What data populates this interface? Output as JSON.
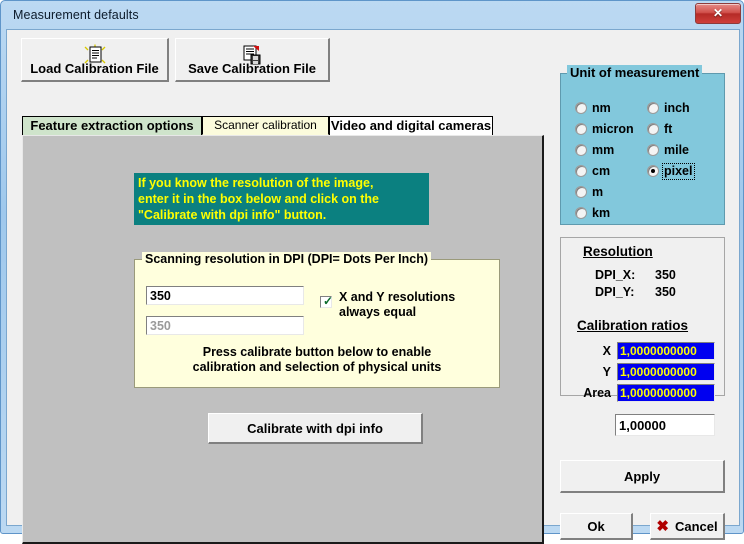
{
  "window": {
    "title": "Measurement defaults",
    "close_label": "✕"
  },
  "toolbar": {
    "load_label": "Load Calibration File",
    "load_icon": "document-sparkle-icon",
    "save_label": "Save Calibration File",
    "save_icon": "document-floppy-icon"
  },
  "tabs": [
    {
      "label": "Feature extraction options",
      "active": false
    },
    {
      "label": "Scanner calibration",
      "active": true
    },
    {
      "label": "Video and digital cameras",
      "active": false
    }
  ],
  "info_box": {
    "line1": "If you know the resolution of the image,",
    "line2": "enter it in the box below and click on the",
    "line3": "\"Calibrate with dpi info\" button.",
    "bg_color": "#0b8080",
    "text_color": "#ffff00"
  },
  "dpi_group": {
    "legend": "Scanning resolution in DPI  (DPI= Dots Per Inch)",
    "x_value": "350",
    "y_value": "350",
    "y_disabled": true,
    "checkbox_checked": true,
    "checkbox_label_line1": "X and Y resolutions",
    "checkbox_label_line2": "always equal",
    "note_line1": "Press calibrate button below to enable",
    "note_line2": "calibration and selection of physical units"
  },
  "calibrate_button": {
    "label": "Calibrate with dpi info"
  },
  "unit_group": {
    "legend": "Unit of measurement",
    "selected": "pixel",
    "left_column": [
      "nm",
      "micron",
      "mm",
      "cm",
      "m",
      "km"
    ],
    "right_column": [
      "inch",
      "ft",
      "mile",
      "pixel"
    ],
    "bg_color": "#82c8dc"
  },
  "resolution": {
    "title": "Resolution",
    "dpi_x_label": "DPI_X:",
    "dpi_x_value": "350",
    "dpi_y_label": "DPI_Y:",
    "dpi_y_value": "350",
    "ratios_title": "Calibration ratios",
    "x_label": "X",
    "x_value": "1,0000000000",
    "y_label": "Y",
    "y_value": "1,0000000000",
    "area_label": "Area",
    "area_value": "1,0000000000",
    "extra_value": "1,00000",
    "field_bg": "#0000f0",
    "field_fg": "#ffff00"
  },
  "actions": {
    "apply_label": "Apply",
    "ok_label": "Ok",
    "cancel_label": "Cancel",
    "cancel_icon": "red-x-icon"
  }
}
